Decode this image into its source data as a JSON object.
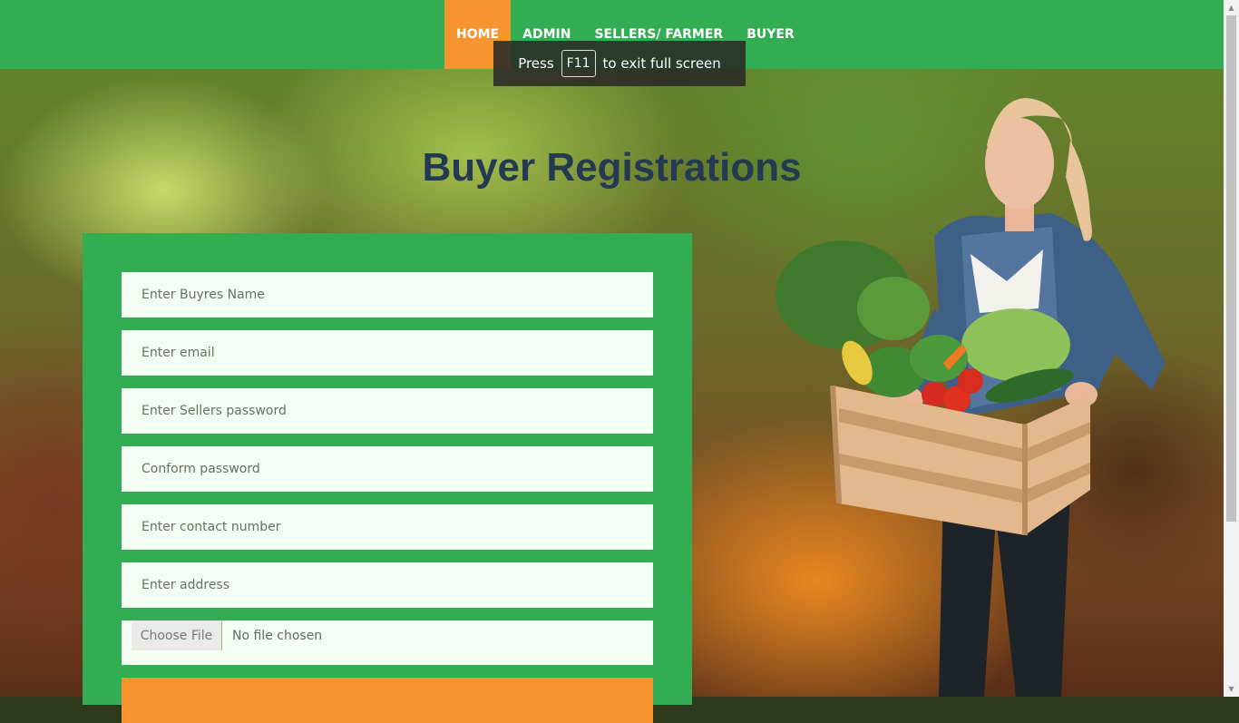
{
  "nav": {
    "items": [
      {
        "label": "HOME",
        "active": true
      },
      {
        "label": "ADMIN",
        "active": false
      },
      {
        "label": "SELLERS/ FARMER",
        "active": false
      },
      {
        "label": "BUYER",
        "active": false
      }
    ]
  },
  "fullscreen_notice": {
    "prefix": "Press",
    "key": "F11",
    "suffix": "to exit full screen"
  },
  "page_title": "Buyer Registrations",
  "form": {
    "name_placeholder": "Enter Buyres Name",
    "email_placeholder": "Enter email",
    "password_placeholder": "Enter Sellers password",
    "confirm_placeholder": "Conform password",
    "contact_placeholder": "Enter contact number",
    "address_placeholder": "Enter address",
    "file_button": "Choose File",
    "file_status": "No file chosen",
    "submit_label": ""
  },
  "colors": {
    "nav_green": "#33ad52",
    "accent_orange": "#f7942f",
    "title_navy": "#243a52",
    "field_bg": "#f4fff3"
  },
  "icons": {
    "scroll_up": "▲",
    "scroll_down": "▼"
  }
}
